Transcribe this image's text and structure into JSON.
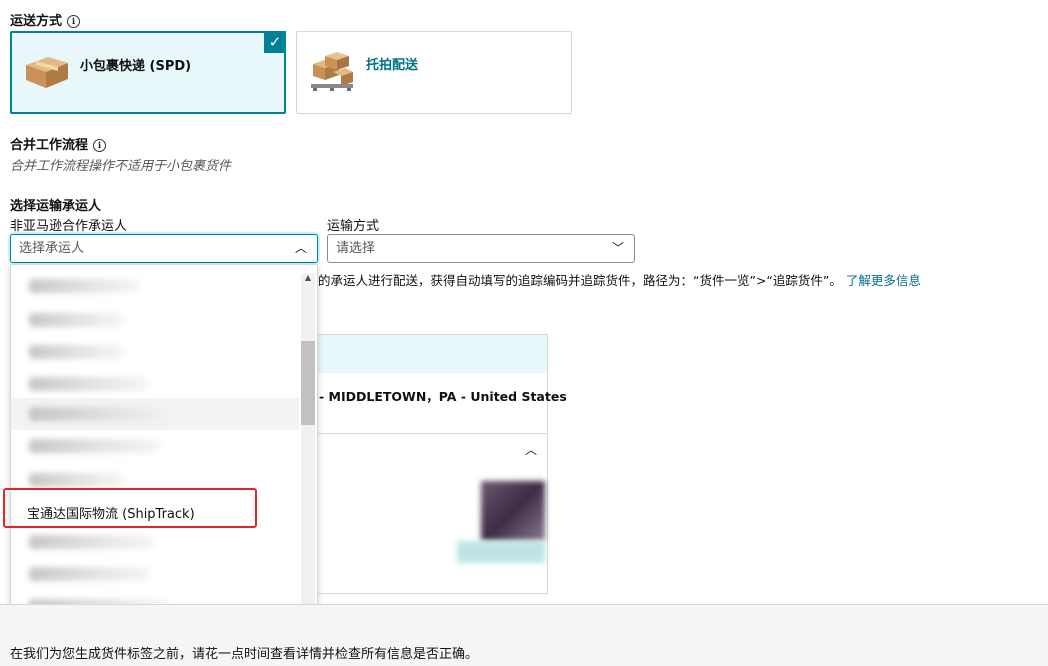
{
  "shipping_method": {
    "title": "运送方式",
    "options": [
      {
        "label": "小包裹快递 (SPD)",
        "selected": true
      },
      {
        "label": "托拍配送",
        "selected": false
      }
    ]
  },
  "workflow": {
    "title": "合并工作流程",
    "note": "合并工作流程操作不适用于小包裹货件"
  },
  "carrier": {
    "section_title": "选择运输承运人",
    "non_partner_label": "非亚马逊合作承运人",
    "carrier_placeholder": "选择承运人",
    "transport_label": "运输方式",
    "transport_placeholder": "请选择",
    "info_text": "的承运人进行配送，获得自动填写的追踪编码并追踪货件，路径为：“货件一览”>“追踪货件”。",
    "learn_more": "了解更多信息",
    "highlighted_option": "宝通达国际物流 (ShipTrack)"
  },
  "address": {
    "text": "- MIDDLETOWN，PA - United States"
  },
  "footer": {
    "text": "在我们为您生成货件标签之前，请花一点时间查看详情并检查所有信息是否正确。"
  },
  "colors": {
    "accent": "#008296",
    "highlight_box": "#e3242b",
    "link": "#007185"
  }
}
